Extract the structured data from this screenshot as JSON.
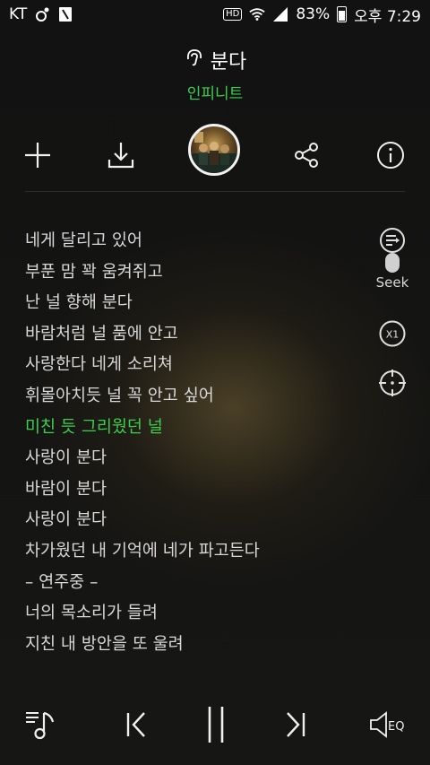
{
  "status_bar": {
    "carrier": "KT",
    "hd": "HD",
    "battery": "83%",
    "time": "오후 7:29",
    "icons": [
      "carrier-app-icon",
      "notification-icon",
      "wifi-icon",
      "signal-icon",
      "battery-icon"
    ]
  },
  "song": {
    "title": "분다",
    "artist": "인피니트",
    "title_icon": "earphone-icon"
  },
  "actions": [
    "add-icon",
    "download-icon",
    "album-art",
    "share-icon",
    "info-icon"
  ],
  "lyrics": {
    "lines": [
      "네게 달리고 있어",
      "부푼 맘 꽉 움켜쥐고",
      "난 널 향해 분다",
      "바람처럼 널 품에 안고",
      "사랑한다 네게 소리쳐",
      "휘몰아치듯 널 꼭 안고 싶어",
      "미친 듯 그리웠던 널",
      "사랑이 분다",
      "바람이 분다",
      "사랑이 분다",
      "차가웠던 내 기억에 네가 파고든다",
      "– 연주중 –",
      "너의 목소리가 들려",
      "지친 내 방안을 또 울려"
    ],
    "active_index": 6
  },
  "side": {
    "seek_label": "Seek",
    "speed_label": "X1"
  },
  "colors": {
    "accent": "#3ccf4e",
    "text": "#d8d8d8",
    "background": "#141414"
  },
  "bottom": {
    "eq_label": "EQ"
  }
}
